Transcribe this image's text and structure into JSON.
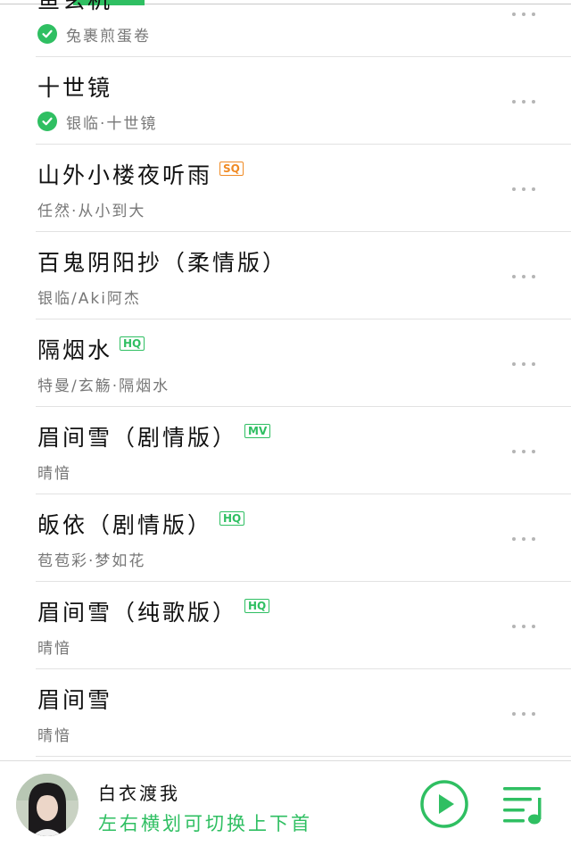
{
  "song_list": [
    {
      "title": "鱼玄机",
      "artist": "兔裹煎蛋卷",
      "downloaded": true,
      "badge": ""
    },
    {
      "title": "十世镜",
      "artist": "银临·十世镜",
      "downloaded": true,
      "badge": ""
    },
    {
      "title": "山外小楼夜听雨",
      "artist": "任然·从小到大",
      "downloaded": false,
      "badge": "SQ"
    },
    {
      "title": "百鬼阴阳抄（柔情版）",
      "artist": "银临/Aki阿杰",
      "downloaded": false,
      "badge": ""
    },
    {
      "title": "隔烟水",
      "artist": "特曼/玄觞·隔烟水",
      "downloaded": false,
      "badge": "HQ"
    },
    {
      "title": "眉间雪（剧情版）",
      "artist": "晴愔",
      "downloaded": false,
      "badge": "MV"
    },
    {
      "title": "皈依（剧情版）",
      "artist": "苞苞彩·梦如花",
      "downloaded": false,
      "badge": "HQ"
    },
    {
      "title": "眉间雪（纯歌版）",
      "artist": "晴愔",
      "downloaded": false,
      "badge": "HQ"
    },
    {
      "title": "眉间雪",
      "artist": "晴愔",
      "downloaded": false,
      "badge": ""
    }
  ],
  "player": {
    "now_playing_title": "白衣渡我",
    "hint": "左右横划可切换上下首",
    "play_icon": "play-circle-icon",
    "playlist_icon": "playlist-icon"
  },
  "colors": {
    "accent": "#2fbf62",
    "sq_badge": "#f08a24",
    "secondary_text": "#777777",
    "divider": "#e2e2e2"
  }
}
